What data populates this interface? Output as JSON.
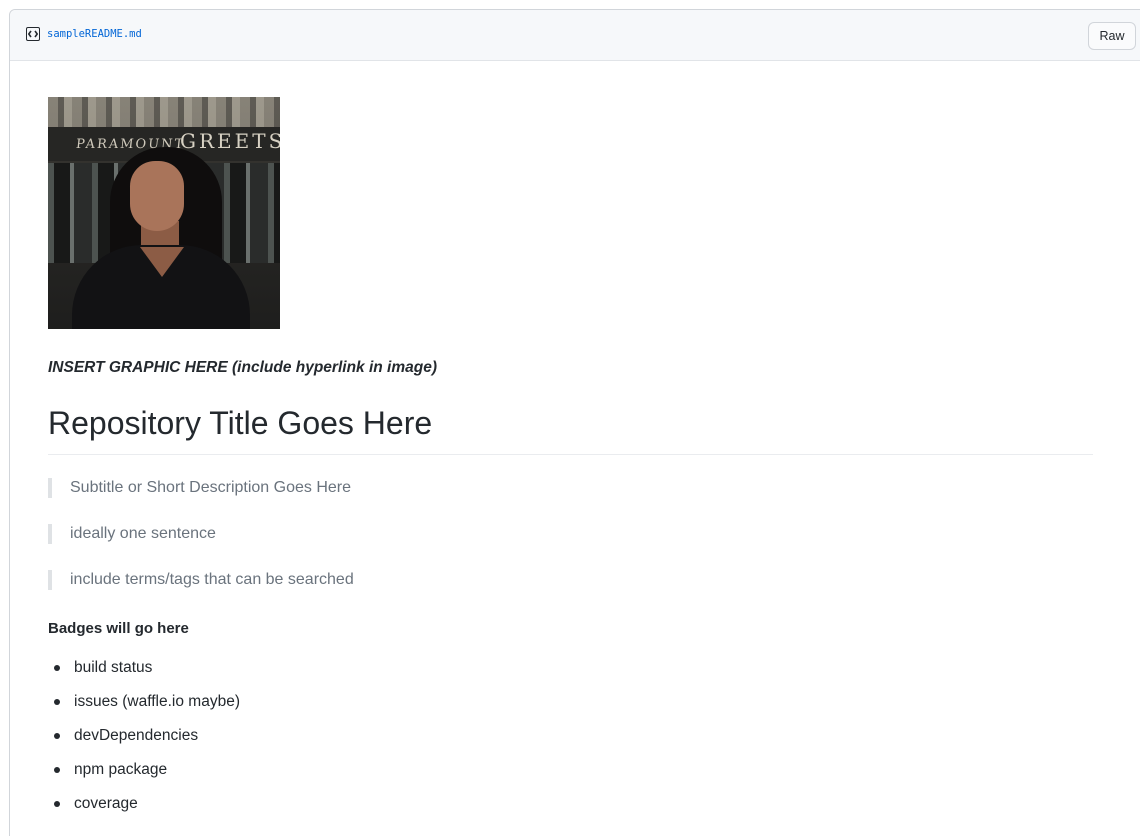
{
  "file_header": {
    "icon": "code-file-icon",
    "filename": "sampleREADME.md",
    "raw_label": "Raw"
  },
  "readme": {
    "image": {
      "icon": "portrait-photo",
      "sign_left": "PARAMOUNT",
      "sign_right": "GREETS"
    },
    "caption": "INSERT GRAPHIC HERE (include hyperlink in image)",
    "title": "Repository Title Goes Here",
    "blockquotes": [
      "Subtitle or Short Description Goes Here",
      "ideally one sentence",
      "include terms/tags that can be searched"
    ],
    "badges_heading": "Badges will go here",
    "badges": [
      "build status",
      "issues (waffle.io maybe)",
      "devDependencies",
      "npm package",
      "coverage"
    ]
  },
  "colors": {
    "link": "#0366d6",
    "text": "#24292e",
    "muted": "#6a737d",
    "border": "#d1d5da"
  }
}
